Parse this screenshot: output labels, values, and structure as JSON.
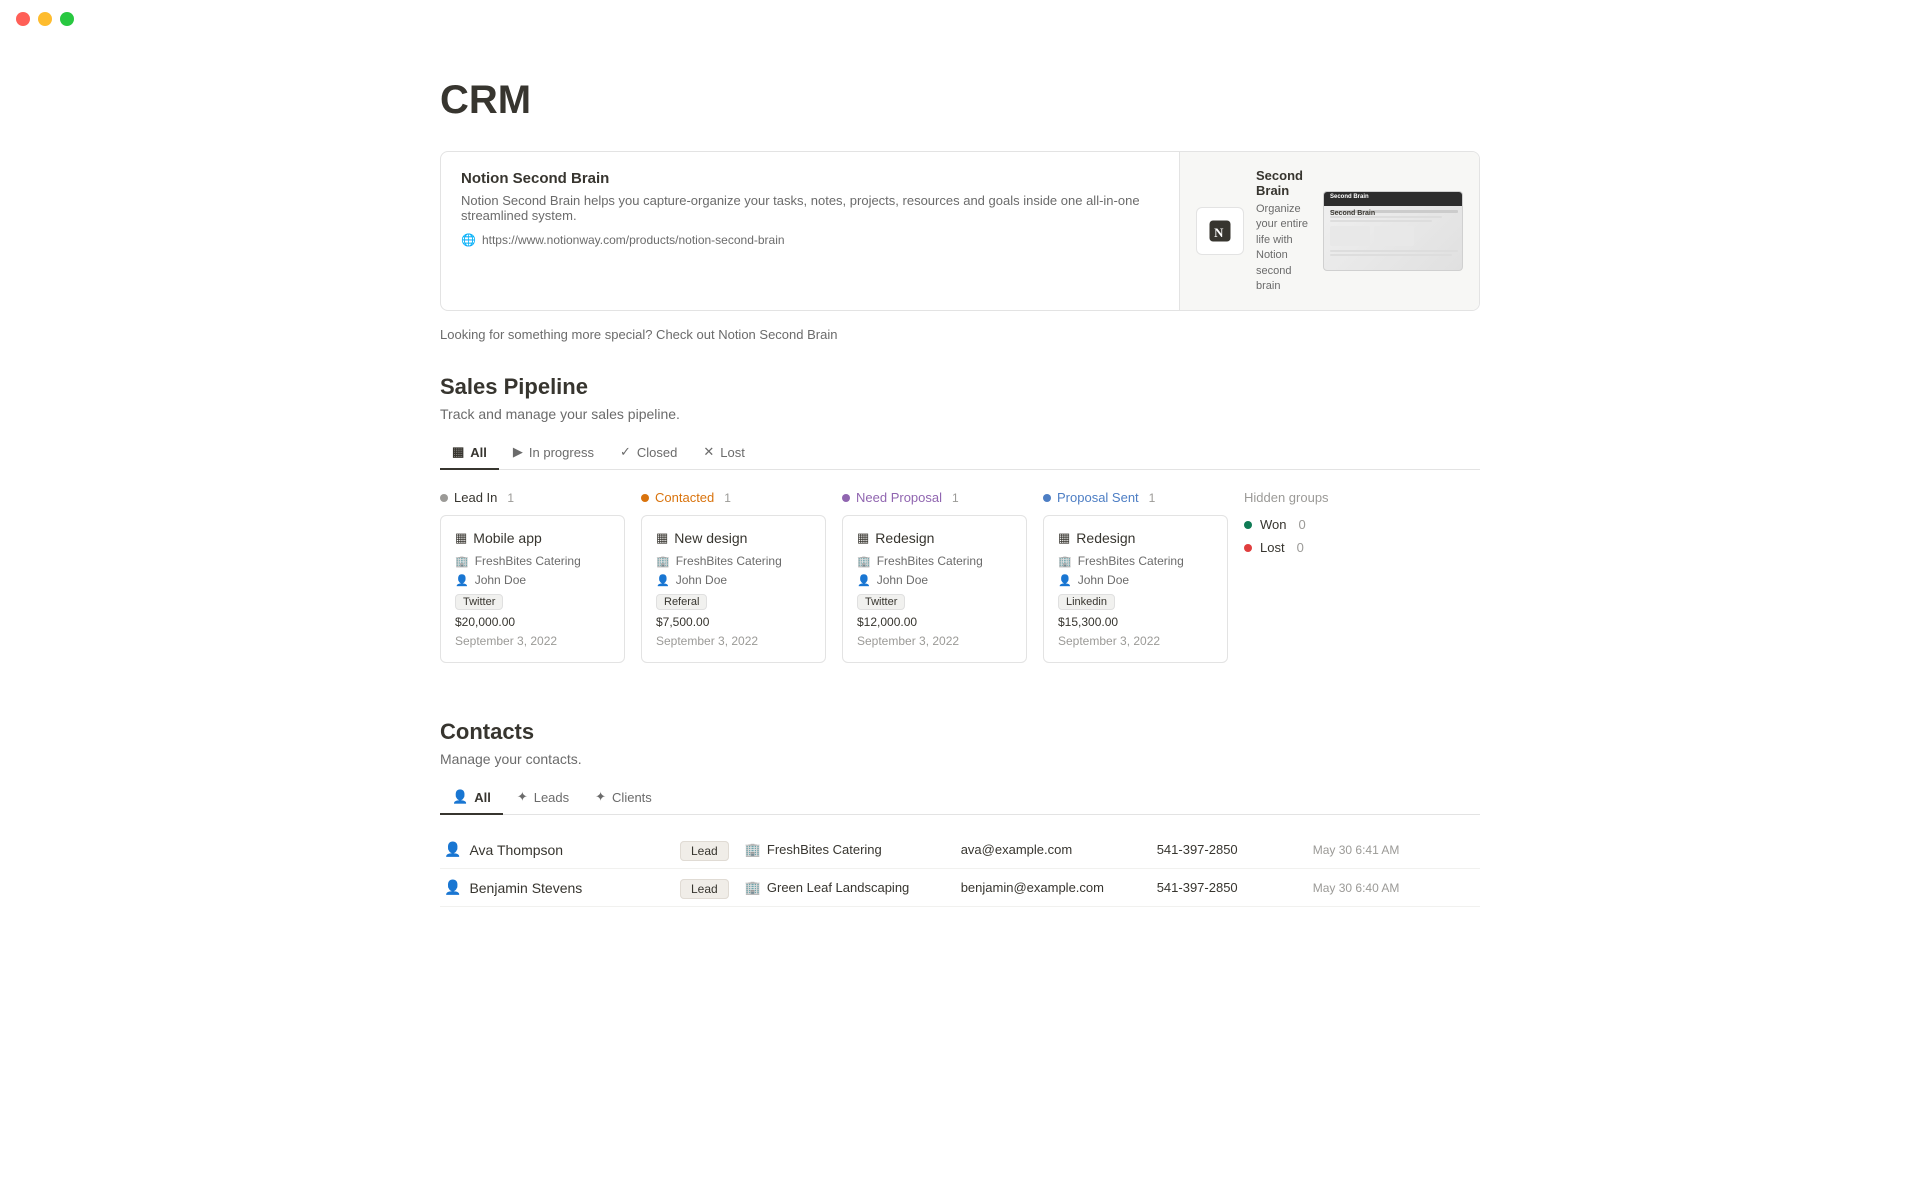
{
  "window": {
    "title": "CRM"
  },
  "page": {
    "title": "CRM"
  },
  "banner": {
    "title": "Notion Second Brain",
    "description": "Notion Second Brain helps you capture-organize your tasks, notes, projects, resources and goals inside one all-in-one streamlined system.",
    "url": "https://www.notionway.com/products/notion-second-brain",
    "preview_title": "Second Brain",
    "preview_subtitle": "Organize your entire life with Notion second brain",
    "preview_screenshot_label": "Second Brain"
  },
  "looking_for": "Looking for something more special? Check out Notion Second Brain",
  "sales_pipeline": {
    "title": "Sales Pipeline",
    "subtitle": "Track and manage your sales pipeline.",
    "tabs": [
      {
        "label": "All",
        "icon": "▦",
        "active": true
      },
      {
        "label": "In progress",
        "icon": "▶",
        "active": false
      },
      {
        "label": "Closed",
        "icon": "✓",
        "active": false
      },
      {
        "label": "Lost",
        "icon": "✕",
        "active": false
      }
    ],
    "columns": [
      {
        "id": "lead-in",
        "label": "Lead In",
        "dot_class": "dot-gray",
        "count": 1,
        "cards": [
          {
            "title": "Mobile app",
            "company": "FreshBites Catering",
            "person": "John Doe",
            "tag": "Twitter",
            "amount": "$20,000.00",
            "date": "September 3, 2022"
          }
        ]
      },
      {
        "id": "contacted",
        "label": "Contacted",
        "dot_class": "dot-orange",
        "label_class": "label-contacted",
        "count": 1,
        "cards": [
          {
            "title": "New design",
            "company": "FreshBites Catering",
            "person": "John Doe",
            "tag": "Referal",
            "amount": "$7,500.00",
            "date": "September 3, 2022"
          }
        ]
      },
      {
        "id": "need-proposal",
        "label": "Need Proposal",
        "dot_class": "dot-purple",
        "label_class": "label-need-proposal",
        "count": 1,
        "cards": [
          {
            "title": "Redesign",
            "company": "FreshBites Catering",
            "person": "John Doe",
            "tag": "Twitter",
            "amount": "$12,000.00",
            "date": "September 3, 2022"
          }
        ]
      },
      {
        "id": "proposal-sent",
        "label": "Proposal Sent",
        "dot_class": "dot-blue",
        "label_class": "label-proposal-sent",
        "count": 1,
        "cards": [
          {
            "title": "Redesign",
            "company": "FreshBites Catering",
            "person": "John Doe",
            "tag": "Linkedin",
            "amount": "$15,300.00",
            "date": "September 3, 2022"
          }
        ]
      }
    ],
    "hidden_groups": {
      "label": "Hidden groups",
      "items": [
        {
          "label": "Won",
          "dot_class": "dot-green",
          "count": 0
        },
        {
          "label": "Lost",
          "dot_class": "dot-red",
          "count": 0
        }
      ]
    }
  },
  "contacts": {
    "title": "Contacts",
    "subtitle": "Manage your contacts.",
    "tabs": [
      {
        "label": "All",
        "icon": "👤",
        "active": true
      },
      {
        "label": "Leads",
        "icon": "✦",
        "active": false
      },
      {
        "label": "Clients",
        "icon": "✦",
        "active": false
      }
    ],
    "rows": [
      {
        "name": "Ava Thompson",
        "badge": "Lead",
        "company": "FreshBites Catering",
        "email": "ava@example.com",
        "phone": "541-397-2850",
        "date": "May 30 6:41 AM"
      },
      {
        "name": "Benjamin Stevens",
        "badge": "Lead",
        "company": "Green Leaf Landscaping",
        "email": "benjamin@example.com",
        "phone": "541-397-2850",
        "date": "May 30 6:40 AM"
      }
    ]
  }
}
